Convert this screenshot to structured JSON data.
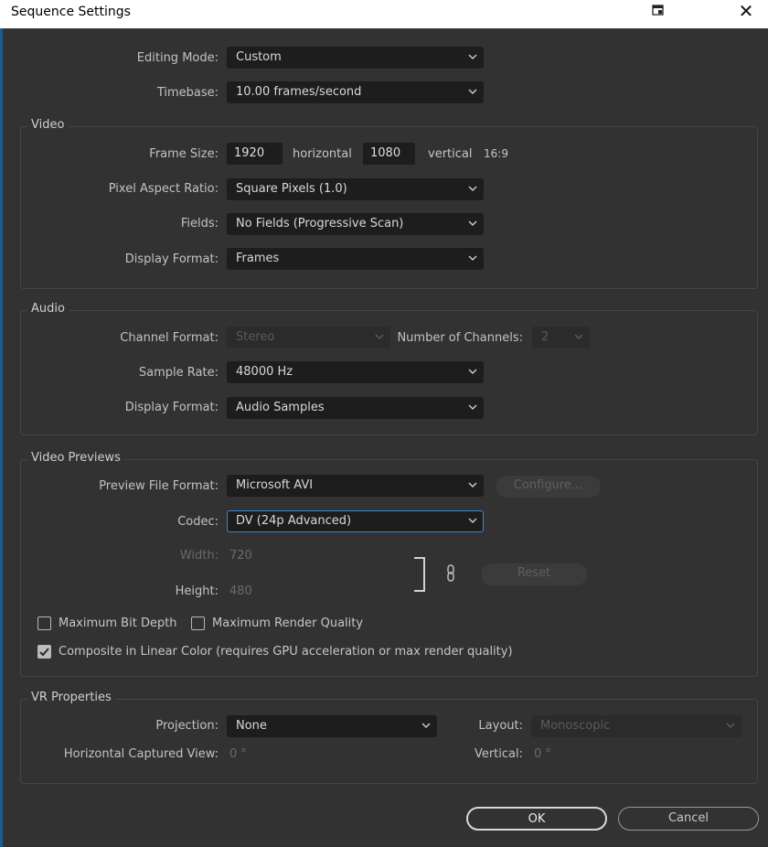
{
  "window": {
    "title": "Sequence Settings",
    "close_glyph": "✕"
  },
  "general": {
    "editing_mode_label": "Editing Mode:",
    "editing_mode_value": "Custom",
    "timebase_label": "Timebase:",
    "timebase_value": "10.00  frames/second"
  },
  "video": {
    "title": "Video",
    "frame_size_label": "Frame Size:",
    "frame_width": "1920",
    "horizontal_label": "horizontal",
    "frame_height": "1080",
    "vertical_label": "vertical",
    "aspect_ratio_text": "16:9",
    "pixel_aspect_label": "Pixel Aspect Ratio:",
    "pixel_aspect_value": "Square Pixels (1.0)",
    "fields_label": "Fields:",
    "fields_value": "No Fields (Progressive Scan)",
    "display_format_label": "Display Format:",
    "display_format_value": "Frames"
  },
  "audio": {
    "title": "Audio",
    "channel_format_label": "Channel Format:",
    "channel_format_value": "Stereo",
    "num_channels_label": "Number of Channels:",
    "num_channels_value": "2",
    "sample_rate_label": "Sample Rate:",
    "sample_rate_value": "48000 Hz",
    "display_format_label": "Display Format:",
    "display_format_value": "Audio Samples"
  },
  "previews": {
    "title": "Video Previews",
    "file_format_label": "Preview File Format:",
    "file_format_value": "Microsoft AVI",
    "configure_label": "Configure...",
    "codec_label": "Codec:",
    "codec_value": "DV (24p Advanced)",
    "width_label": "Width:",
    "width_value": "720",
    "height_label": "Height:",
    "height_value": "480",
    "reset_label": "Reset",
    "max_bit_depth_label": "Maximum Bit Depth",
    "max_bit_depth_checked": false,
    "max_render_quality_label": "Maximum Render Quality",
    "max_render_quality_checked": false,
    "linear_color_label": "Composite in Linear Color (requires GPU acceleration or max render quality)",
    "linear_color_checked": true
  },
  "vr": {
    "title": "VR Properties",
    "projection_label": "Projection:",
    "projection_value": "None",
    "layout_label": "Layout:",
    "layout_value": "Monoscopic",
    "h_view_label": "Horizontal Captured View:",
    "h_view_value": "0 °",
    "vertical_label": "Vertical:",
    "vertical_value": "0 °"
  },
  "buttons": {
    "ok": "OK",
    "cancel": "Cancel"
  },
  "colors": {
    "dialog_bg": "#323232",
    "field_bg": "#1d1d1d",
    "focus_border": "#3b86d9",
    "title_bar": "#ffffff"
  }
}
